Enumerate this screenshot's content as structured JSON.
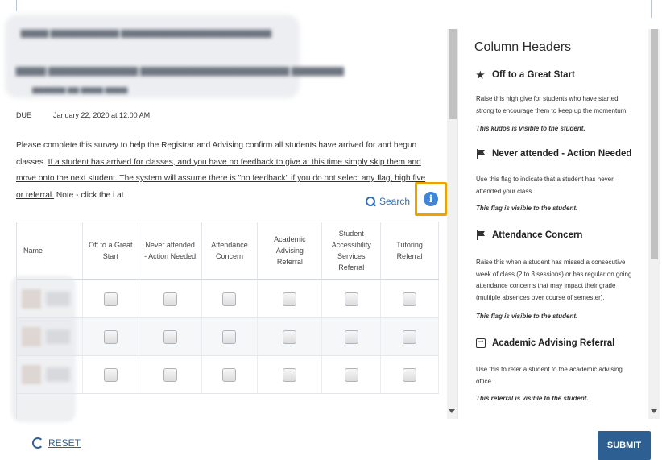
{
  "due": {
    "label": "DUE",
    "value": "January 22, 2020 at 12:00 AM"
  },
  "instructions": {
    "intro": "Please complete this survey to help the Registrar and Advising confirm all students have arrived for and begun classes. ",
    "underlined": "If a student has arrived for classes, and you have no feedback to give at this time simply skip them and move onto the next student. The system will assume there is \"no feedback\" if you do not select any flag, high five or referral.",
    "tail": " Note - click the i at"
  },
  "search": {
    "label": "Search"
  },
  "table": {
    "columns": [
      "Name",
      "Off to a Great Start",
      "Never attended - Action Needed",
      "Attendance Concern",
      "Academic Advising Referral",
      "Student Accessibility Services Referral",
      "Tutoring Referral"
    ]
  },
  "panel": {
    "title": "Column Headers",
    "items": [
      {
        "icon": "star-icon",
        "title": "Off to a Great Start",
        "desc": "Raise this high give for students who have started strong to encourage them to keep up the momentum",
        "note": "This kudos is visible to the student."
      },
      {
        "icon": "flag-icon",
        "title": "Never attended - Action Needed",
        "desc": "Use this flag to indicate that a student has never attended your class.",
        "note": "This flag is visible to the student."
      },
      {
        "icon": "flag-icon",
        "title": "Attendance Concern",
        "desc": "Raise this when a student has missed a consecutive week of class (2 to 3 sessions) or has regular on going attendance concerns that may impact their grade (multiple absences over course of semester).",
        "note": "This flag is visible to the student."
      },
      {
        "icon": "referral-icon",
        "title": "Academic Advising Referral",
        "desc": "Use this to refer a student to the academic advising office.",
        "note": "This referral is visible to the student."
      }
    ]
  },
  "footer": {
    "reset": "RESET",
    "submit": "SUBMIT"
  },
  "colors": {
    "accent": "#2e5f92",
    "highlight": "#eaa300",
    "info": "#3d86d8"
  }
}
